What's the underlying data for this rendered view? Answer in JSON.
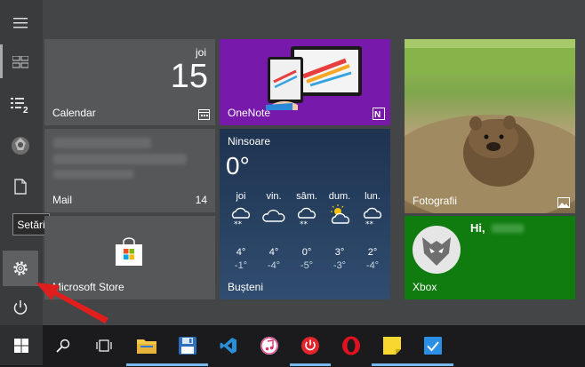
{
  "rail": {
    "tooltip": "Setări"
  },
  "tiles": {
    "calendar": {
      "day": "joi",
      "date": "15",
      "label": "Calendar"
    },
    "mail": {
      "label": "Mail",
      "count": "14"
    },
    "store": {
      "label": "Microsoft Store"
    },
    "onenote": {
      "label": "OneNote"
    },
    "weather": {
      "location": "Ninsoare",
      "temperature": "0°",
      "city": "Bușteni",
      "forecast": [
        {
          "day": "joi",
          "high": "4°",
          "low": "-1°",
          "icon": "snow-cloud-icon"
        },
        {
          "day": "vin.",
          "high": "4°",
          "low": "-4°",
          "icon": "cloud-icon"
        },
        {
          "day": "sâm.",
          "high": "0°",
          "low": "-5°",
          "icon": "snow-cloud-icon"
        },
        {
          "day": "dum.",
          "high": "3°",
          "low": "-3°",
          "icon": "partly-sunny-icon"
        },
        {
          "day": "lun.",
          "high": "2°",
          "low": "-4°",
          "icon": "snow-cloud-icon"
        }
      ]
    },
    "photos": {
      "label": "Fotografii"
    },
    "xbox": {
      "greeting": "Hi,",
      "label": "Xbox"
    }
  },
  "colors": {
    "accent": "#0078d7",
    "onenote": "#7719aa",
    "xbox": "#107c10",
    "arrow": "#e01e1e"
  }
}
